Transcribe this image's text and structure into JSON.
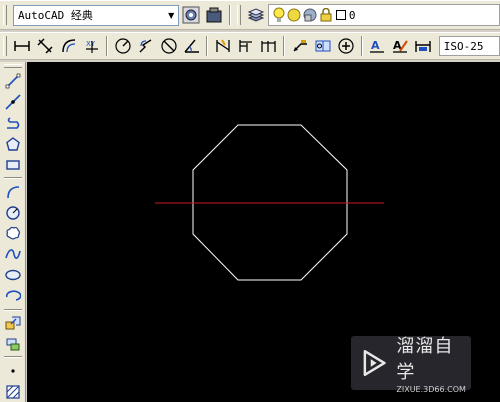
{
  "app": {
    "workspace": "AutoCAD 经典",
    "layer": {
      "name": "0"
    },
    "dim_style": "ISO-25"
  },
  "colors": {
    "canvas_bg": "#000000",
    "octagon_stroke": "#ffffff",
    "line_stroke": "#cc1a1a"
  },
  "toolbars": {
    "workspace_tools": [
      "workspace-settings-icon",
      "my-workspace-icon"
    ],
    "layer_tools": [
      "layer-manager-icon",
      "layer-on-icon",
      "layer-freeze-icon",
      "layer-color-icon",
      "layer-lock-icon"
    ],
    "dimension_tools": [
      "linear-dim-icon",
      "aligned-dim-icon",
      "arc-length-dim-icon",
      "ordinate-dim-icon",
      "radius-dim-icon",
      "jogged-dim-icon",
      "diameter-dim-icon",
      "angular-dim-icon",
      "quick-dim-icon",
      "baseline-dim-icon",
      "continue-dim-icon",
      "quick-leader-icon",
      "tolerance-icon",
      "center-mark-icon",
      "dim-edit-icon",
      "dim-text-edit-icon",
      "dim-update-icon"
    ],
    "draw_tools": [
      "line-icon",
      "construction-line-icon",
      "polyline-icon",
      "polygon-icon",
      "rectangle-icon",
      "arc-icon",
      "circle-icon",
      "revision-cloud-icon",
      "spline-icon",
      "ellipse-icon",
      "ellipse-arc-icon",
      "insert-block-icon",
      "make-block-icon",
      "point-icon",
      "hatch-icon"
    ]
  },
  "watermark": {
    "title": "溜溜自学",
    "url": "ZIXUE.3D66.COM"
  }
}
